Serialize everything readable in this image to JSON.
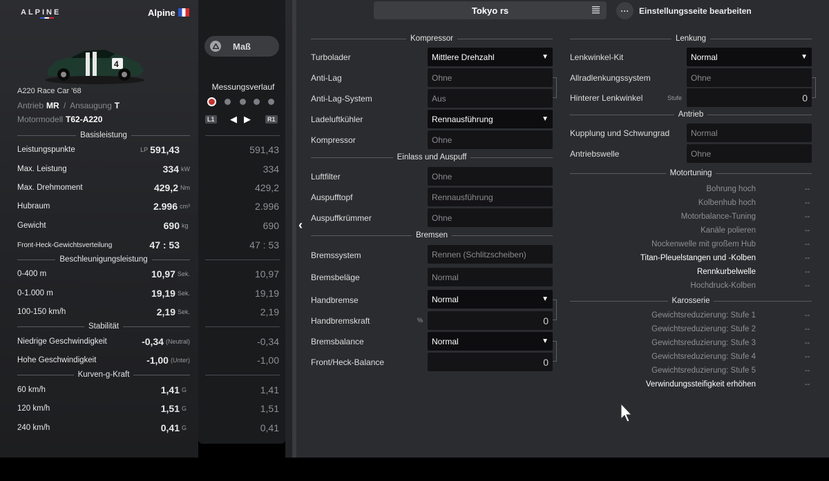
{
  "header": {
    "brand": "ALPINE",
    "maker": "Alpine",
    "tuning_sheet": "Tokyo rs",
    "edit_label": "Einstellungsseite bearbeiten",
    "more_icon": "···"
  },
  "car": {
    "name": "A220 Race Car '68",
    "drive_label": "Antrieb",
    "drive": "MR",
    "sep": "/",
    "aspiration_label": "Ansaugung",
    "aspiration": "T",
    "engine_label": "Motormodell",
    "engine": "T62-A220"
  },
  "stats": {
    "basis": {
      "title": "Basisleistung",
      "rows": [
        {
          "label": "Leistungspunkte",
          "prefix": "LP",
          "value": "591,43",
          "unit": "",
          "measured": "591,43"
        },
        {
          "label": "Max. Leistung",
          "prefix": "",
          "value": "334",
          "unit": "kW",
          "measured": "334"
        },
        {
          "label": "Max. Drehmoment",
          "prefix": "",
          "value": "429,2",
          "unit": "Nm",
          "measured": "429,2"
        },
        {
          "label": "Hubraum",
          "prefix": "",
          "value": "2.996",
          "unit": "cm³",
          "measured": "2.996"
        },
        {
          "label": "Gewicht",
          "prefix": "",
          "value": "690",
          "unit": "kg",
          "measured": "690"
        },
        {
          "label": "Front-Heck-Gewichtsverteilung",
          "prefix": "",
          "value": "47 : 53",
          "unit": "",
          "measured": "47 : 53"
        }
      ]
    },
    "accel": {
      "title": "Beschleunigungsleistung",
      "rows": [
        {
          "label": "0-400 m",
          "value": "10,97",
          "unit": "Sek.",
          "measured": "10,97"
        },
        {
          "label": "0-1.000 m",
          "value": "19,19",
          "unit": "Sek.",
          "measured": "19,19"
        },
        {
          "label": "100-150 km/h",
          "value": "2,19",
          "unit": "Sek.",
          "measured": "2,19"
        }
      ]
    },
    "stab": {
      "title": "Stabilität",
      "rows": [
        {
          "label": "Niedrige Geschwindigkeit",
          "value": "-0,34",
          "unit": "(Neutral)",
          "measured": "-0,34"
        },
        {
          "label": "Hohe Geschwindigkeit",
          "value": "-1,00",
          "unit": "(Unter)",
          "measured": "-1,00"
        }
      ]
    },
    "g": {
      "title": "Kurven-g-Kraft",
      "rows": [
        {
          "label": "60 km/h",
          "value": "1,41",
          "unit": "G",
          "measured": "1,41"
        },
        {
          "label": "120 km/h",
          "value": "1,51",
          "unit": "G",
          "measured": "1,51"
        },
        {
          "label": "240 km/h",
          "value": "0,41",
          "unit": "G",
          "measured": "0,41"
        }
      ]
    }
  },
  "measure": {
    "button": "Maß",
    "history_title": "Messungsverlauf",
    "l1": "L1",
    "r1": "R1"
  },
  "sections": {
    "kompressor": {
      "title": "Kompressor",
      "fields": [
        {
          "label": "Turbolader",
          "value": "Mittlere Drehzahl",
          "dropdown": true
        },
        {
          "label": "Anti-Lag",
          "value": "Ohne",
          "dropdown": false
        },
        {
          "label": "Anti-Lag-System",
          "value": "Aus",
          "dropdown": false
        },
        {
          "label": "Ladeluftkühler",
          "value": "Rennausführung",
          "dropdown": true
        },
        {
          "label": "Kompressor",
          "value": "Ohne",
          "dropdown": false
        }
      ]
    },
    "einlass": {
      "title": "Einlass und Auspuff",
      "fields": [
        {
          "label": "Luftfilter",
          "value": "Ohne"
        },
        {
          "label": "Auspufftopf",
          "value": "Rennausführung"
        },
        {
          "label": "Auspuffkrümmer",
          "value": "Ohne"
        }
      ]
    },
    "bremsen": {
      "title": "Bremsen",
      "fields": [
        {
          "label": "Bremssystem",
          "value": "Rennen (Schlitzscheiben)"
        },
        {
          "label": "Bremsbeläge",
          "value": "Normal"
        },
        {
          "label": "Handbremse",
          "value": "Normal"
        },
        {
          "label": "Handbremskraft",
          "unit": "%",
          "value": "0"
        },
        {
          "label": "Bremsbalance",
          "value": "Normal"
        },
        {
          "label": "Front/Heck-Balance",
          "value": "0"
        }
      ]
    },
    "lenkung": {
      "title": "Lenkung",
      "fields": [
        {
          "label": "Lenkwinkel-Kit",
          "value": "Normal"
        },
        {
          "label": "Allradlenkungssystem",
          "value": "Ohne"
        },
        {
          "label": "Hinterer Lenkwinkel",
          "unit": "Stufe",
          "value": "0"
        }
      ]
    },
    "antrieb": {
      "title": "Antrieb",
      "fields": [
        {
          "label": "Kupplung und Schwungrad",
          "value": "Normal"
        },
        {
          "label": "Antriebswelle",
          "value": "Ohne"
        }
      ]
    },
    "motortuning": {
      "title": "Motortuning",
      "items": [
        {
          "label": "Bohrung hoch",
          "value": "--",
          "active": false
        },
        {
          "label": "Kolbenhub hoch",
          "value": "--",
          "active": false
        },
        {
          "label": "Motorbalance-Tuning",
          "value": "--",
          "active": false
        },
        {
          "label": "Kanäle polieren",
          "value": "--",
          "active": false
        },
        {
          "label": "Nockenwelle mit großem Hub",
          "value": "--",
          "active": false
        },
        {
          "label": "Titan-Pleuelstangen und -Kolben",
          "value": "--",
          "active": true
        },
        {
          "label": "Rennkurbelwelle",
          "value": "--",
          "active": true
        },
        {
          "label": "Hochdruck-Kolben",
          "value": "--",
          "active": false
        }
      ]
    },
    "karosserie": {
      "title": "Karosserie",
      "items": [
        {
          "label": "Gewichtsreduzierung: Stufe 1",
          "value": "--",
          "active": false
        },
        {
          "label": "Gewichtsreduzierung: Stufe 2",
          "value": "--",
          "active": false
        },
        {
          "label": "Gewichtsreduzierung: Stufe 3",
          "value": "--",
          "active": false
        },
        {
          "label": "Gewichtsreduzierung: Stufe 4",
          "value": "--",
          "active": false
        },
        {
          "label": "Gewichtsreduzierung: Stufe 5",
          "value": "--",
          "active": false
        },
        {
          "label": "Verwindungssteifigkeit erhöhen",
          "value": "--",
          "active": true
        }
      ]
    }
  }
}
